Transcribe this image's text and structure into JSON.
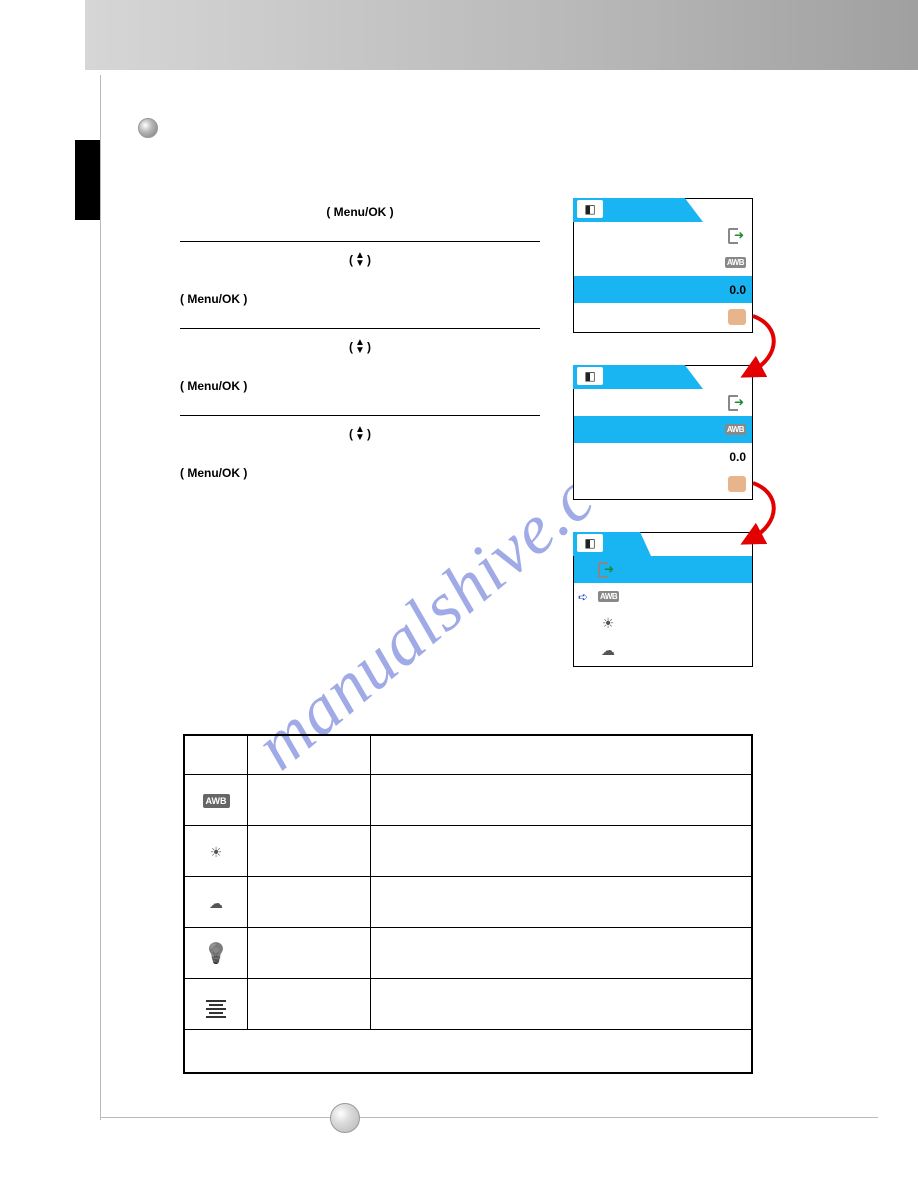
{
  "watermark_text": "manualshive.com",
  "steps": {
    "s1_center": "( Menu/OK )",
    "s2_center": "(  )",
    "s2_left": "( Menu/OK )",
    "s3_center": "(  )",
    "s3_left": "( Menu/OK )",
    "s4_center": "(  )",
    "s4_left": "( Menu/OK )"
  },
  "menu": {
    "exposure_value": "0.0",
    "awb_label": "AWB"
  },
  "table": {
    "head_icon": "",
    "head_name": "",
    "head_desc": "",
    "rows": [
      {
        "label_awb": "AWB",
        "name": "",
        "desc": ""
      },
      {
        "icon_key": "sun",
        "name": "",
        "desc": ""
      },
      {
        "icon_key": "cloud",
        "name": "",
        "desc": ""
      },
      {
        "icon_key": "bulb",
        "name": "",
        "desc": ""
      },
      {
        "icon_key": "fluor",
        "name": "",
        "desc": ""
      }
    ],
    "footer": ""
  }
}
